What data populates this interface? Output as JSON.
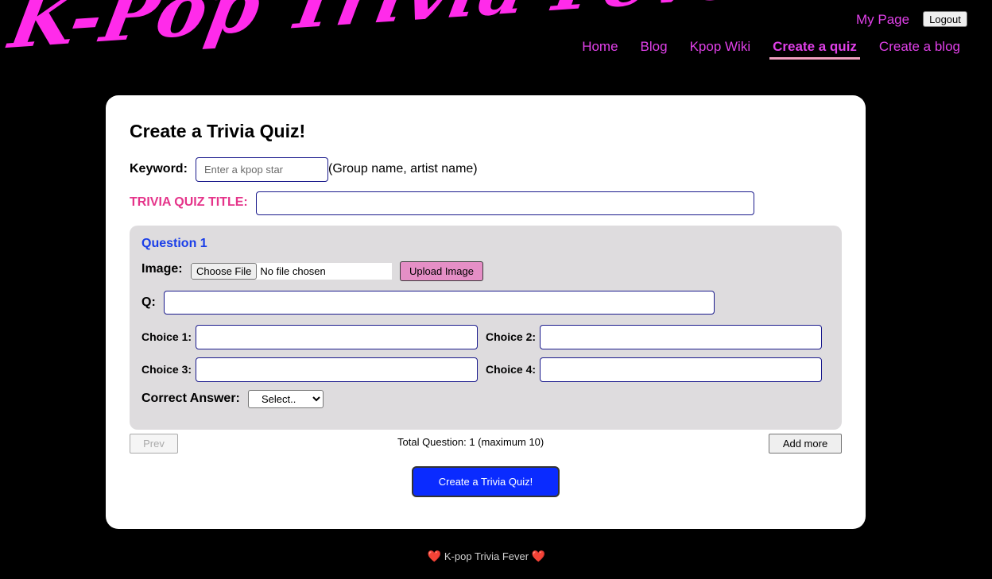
{
  "header": {
    "logo_text": "K-Pop Trivia Fever",
    "my_page": "My Page",
    "logout": "Logout",
    "nav": [
      {
        "label": "Home"
      },
      {
        "label": "Blog"
      },
      {
        "label": "Kpop Wiki"
      },
      {
        "label": "Create a quiz",
        "active": true
      },
      {
        "label": "Create a blog"
      }
    ]
  },
  "form": {
    "title": "Create a Trivia Quiz!",
    "keyword_label": "Keyword:",
    "keyword_placeholder": "Enter a kpop star",
    "keyword_hint": "(Group name, artist name)",
    "quiz_title_label": "TRIVIA QUIZ TITLE:",
    "question": {
      "heading": "Question 1",
      "image_label": "Image:",
      "choose_file": "Choose File",
      "file_status": "No file chosen",
      "upload_button": "Upload Image",
      "q_label": "Q:",
      "choices": [
        {
          "label": "Choice 1:"
        },
        {
          "label": "Choice 2:"
        },
        {
          "label": "Choice 3:"
        },
        {
          "label": "Choice 4:"
        }
      ],
      "correct_answer_label": "Correct Answer:",
      "correct_answer_selected": "Select.."
    },
    "prev_button": "Prev",
    "total_text": "Total Question: 1 (maximum 10)",
    "add_more_button": "Add more",
    "submit_button": "Create a Trivia Quiz!"
  },
  "footer": {
    "text": "K-pop Trivia Fever",
    "heart": "❤️"
  },
  "colors": {
    "accent_pink": "#e040e8",
    "logo_pink": "#ff2bea",
    "quiz_title_pink": "#e5348a",
    "question_blue": "#1a3ee8",
    "submit_blue": "#0a2bff",
    "upload_pink": "#e58fc6"
  }
}
